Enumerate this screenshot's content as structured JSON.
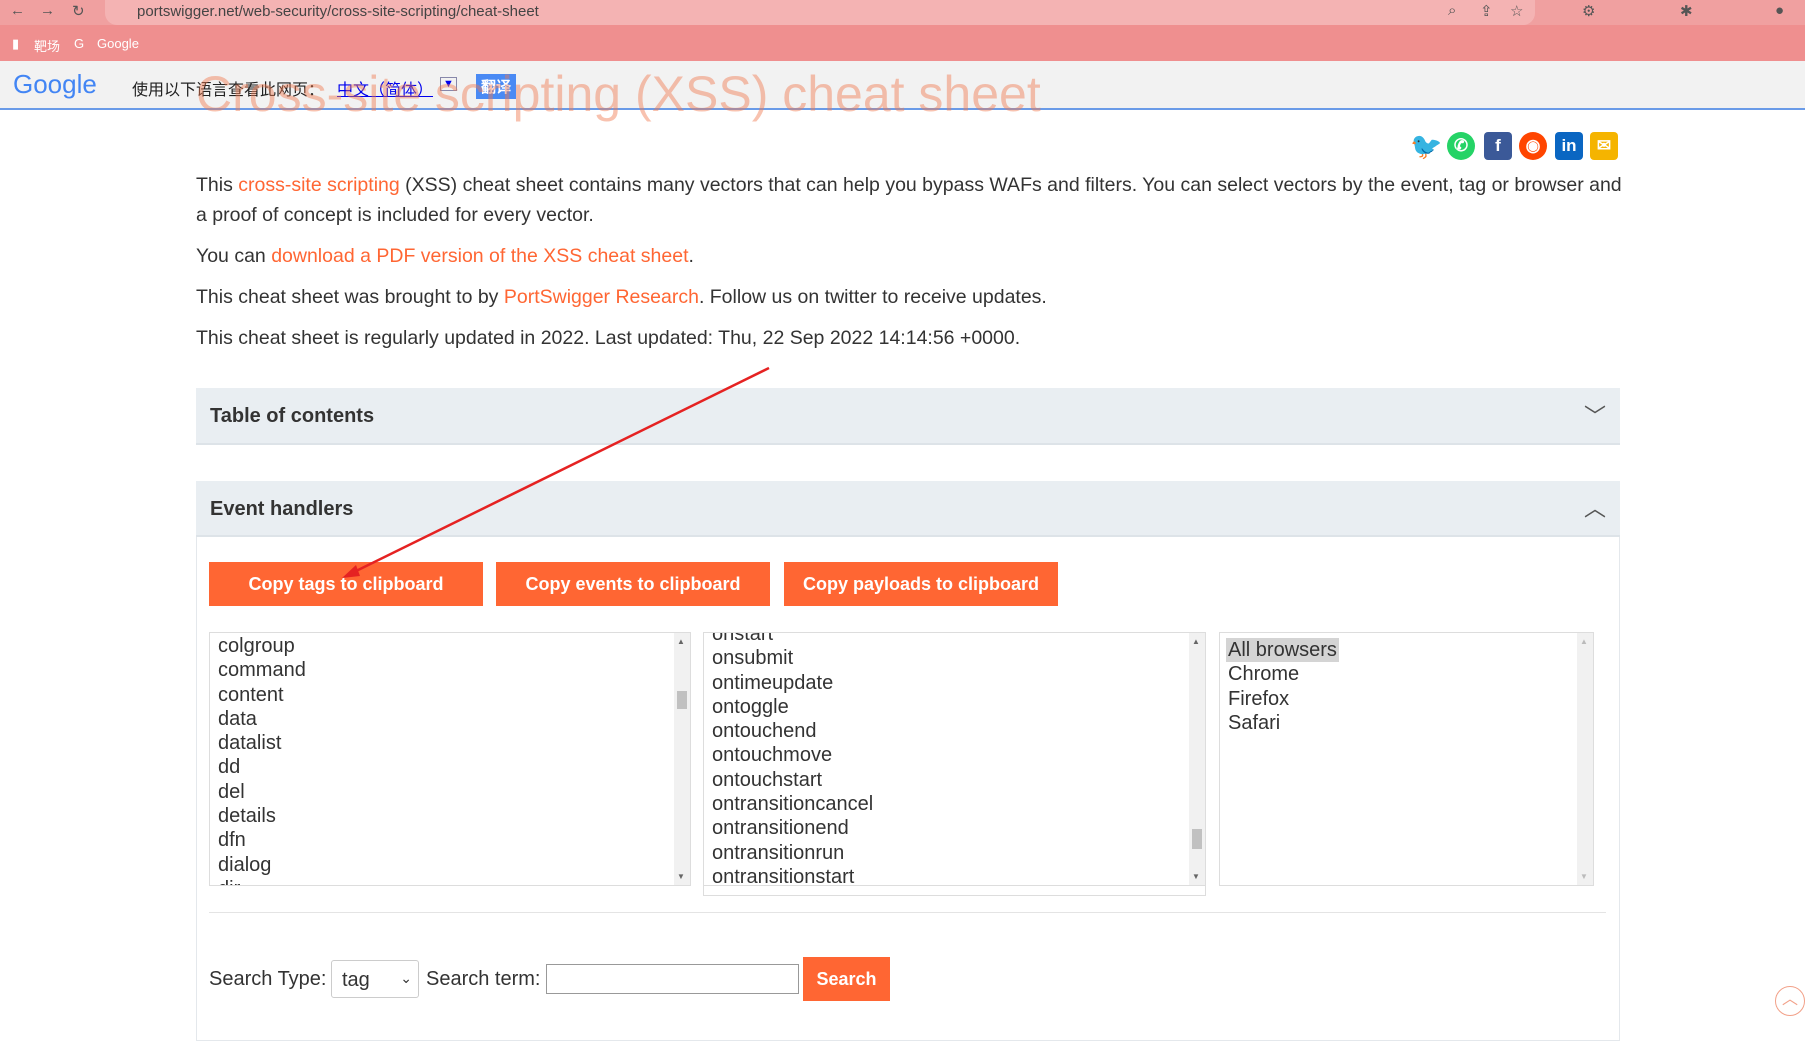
{
  "browser": {
    "url": "portswigger.net/web-security/cross-site-scripting/cheat-sheet",
    "bookmarks": [
      "靶场",
      "Google"
    ]
  },
  "translate": {
    "logo": "Google",
    "prompt": "使用以下语言查看此网页：",
    "language": "中文（简体）",
    "button": "翻译"
  },
  "page": {
    "title": "Cross-site scripting (XSS) cheat sheet",
    "para1_pre": "This ",
    "para1_link": "cross-site scripting",
    "para1_post": " (XSS) cheat sheet contains many vectors that can help you bypass WAFs and filters. You can select vectors by the event, tag or browser and a proof of concept is included for every vector.",
    "para2_pre": "You can ",
    "para2_link": "download a PDF version of the XSS cheat sheet",
    "para2_post": ".",
    "para3_pre": "This cheat sheet was brought to by ",
    "para3_link": "PortSwigger Research",
    "para3_post": ". Follow us on twitter to receive updates.",
    "para4": "This cheat sheet is regularly updated in 2022. Last updated: Thu, 22 Sep 2022 14:14:56 +0000."
  },
  "share": [
    "twitter",
    "whatsapp",
    "facebook",
    "reddit",
    "linkedin",
    "email"
  ],
  "toc": {
    "label": "Table of contents"
  },
  "events": {
    "label": "Event handlers",
    "buttons": [
      "Copy tags to clipboard",
      "Copy events to clipboard",
      "Copy payloads to clipboard"
    ],
    "tags": [
      "colgroup",
      "command",
      "content",
      "data",
      "datalist",
      "dd",
      "del",
      "details",
      "dfn",
      "dialog",
      "dir"
    ],
    "event_list": [
      "onstart",
      "onsubmit",
      "ontimeupdate",
      "ontoggle",
      "ontouchend",
      "ontouchmove",
      "ontouchstart",
      "ontransitioncancel",
      "ontransitionend",
      "ontransitionrun",
      "ontransitionstart"
    ],
    "browsers": [
      "All browsers",
      "Chrome",
      "Firefox",
      "Safari"
    ],
    "selected_browser": "All browsers"
  },
  "search": {
    "type_label": "Search Type:",
    "type_value": "tag",
    "term_label": "Search term:",
    "term_value": "",
    "button": "Search"
  },
  "colors": {
    "accent": "#ff6633",
    "annotation_arrow": "#e52222"
  }
}
